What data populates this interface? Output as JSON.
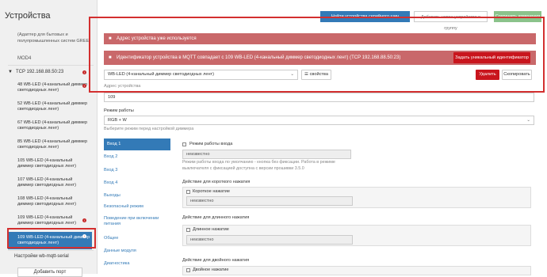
{
  "sidebar": {
    "title": "Устройства",
    "note": "(Адаптер для бытовых и полупромышленных систем GREE)",
    "module": "MOD4",
    "group": "TCP 192.168.88.50:23",
    "items": [
      {
        "label": "48 WB-LED (4-канальный диммер светодиодных лент)",
        "error": "!"
      },
      {
        "label": "52 WB-LED (4-канальный диммер светодиодных лент)"
      },
      {
        "label": "67 WB-LED (4-канальный диммер светодиодных лент)"
      },
      {
        "label": "85 WB-LED (4-канальный диммер светодиодных лент)"
      },
      {
        "label": "105 WB-LED (4-канальный диммер светодиодных лент)"
      },
      {
        "label": "107 WB-LED (4-канальный диммер светодиодных лент)"
      },
      {
        "label": "108 WB-LED (4-канальный диммер светодиодных лент)"
      },
      {
        "label": "109 WB-LED (4-канальный диммер светодиодных лент)",
        "error": "!"
      },
      {
        "label": "109 WB-LED (4-канальный диммер светодиодных лент)",
        "error": "!",
        "active": true
      }
    ],
    "serial": "Настройки wb-mqtt-serial",
    "add_port": "Добавить порт"
  },
  "toolbar": {
    "btn1": "Найти устройства серийного шин",
    "btn2": "Добавить новое устройство в группу",
    "btn3": "Сохранить изменения"
  },
  "alerts": {
    "address_used": "Адрес устройства уже используется",
    "mqtt_dup": "Идентификатор устройства в MQTT совпадает с 109 WB-LED (4-канальный диммер светодиодных лент) (TCP 192.168.88.50:23)",
    "set_unique_id": "Задать уникальный идентификатор"
  },
  "device": {
    "type": "WB-LED (4-канальный диммер светодиодных лент)",
    "props_btn": "свойства",
    "delete_btn": "Удалить",
    "copy_btn": "Скопировать",
    "address_label": "Адрес устройства",
    "address_value": "109",
    "mode_label": "Режим работы",
    "mode_value": "RGB + W",
    "mode_hint": "Выберите режим перед настройкой диммера"
  },
  "tabs": [
    "Вход 1",
    "Вход 2",
    "Вход 3",
    "Вход 4",
    "Выходы",
    "Безопасный режим",
    "Поведение при включении питания",
    "Общее",
    "Данные модуля",
    "Диагностика"
  ],
  "input1": {
    "mode_checkbox": "Режим работы входа",
    "mode_value": "неизвестно",
    "mode_hint": "Режим работы входа по умолчанию - кнопка без фиксации. Работа в режиме выключателя с фиксацией доступна с версии прошивки 3.5.0",
    "short_title": "Действие для короткого нажатия",
    "short_checkbox": "Короткое нажатие",
    "short_value": "неизвестно",
    "long_title": "Действие для длинного нажатия",
    "long_checkbox": "Длинное нажатие",
    "long_value": "неизвестно",
    "double_title": "Действие для двойного нажатия",
    "double_checkbox": "Двойное нажатие"
  },
  "colors": {
    "primary": "#337ab7",
    "danger": "#c9151d",
    "alert_bg": "#c9686a",
    "highlight": "#d32f2f"
  }
}
